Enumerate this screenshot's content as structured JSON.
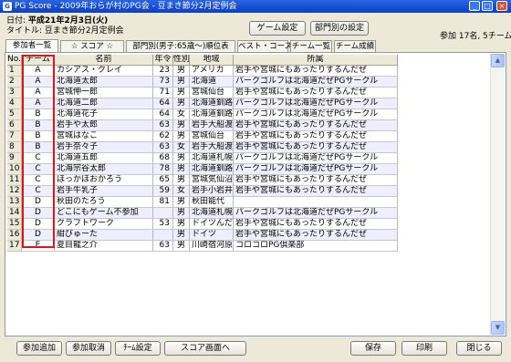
{
  "window": {
    "title": "PG Score - 2009年おらが村のPG会 - 豆まき節分2月定例会",
    "icon": "pg-app-icon"
  },
  "event": {
    "date_label": "日付:",
    "date_value": "平成21年2月3日(火)",
    "title_label": "タイトル:",
    "title_value": "豆まき節分2月定例会"
  },
  "buttons": {
    "game_settings": "ゲーム設定",
    "dept_settings": "部門別の設定"
  },
  "summary": "参加 17名, 5チーム",
  "tabs": [
    "参加者一覧",
    "☆ スコア ☆",
    "部門別(男子:65歳～)順位表",
    "ベスト・コース",
    "チーム一覧",
    "チーム成績"
  ],
  "table": {
    "headers": [
      "No.",
      "チーム",
      "名前",
      "年令",
      "性別",
      "地域",
      "所属"
    ],
    "rows": [
      [
        "1",
        "A",
        "カシアス・クレイ",
        "23",
        "男",
        "アメリカ",
        "岩手や宮城にもあったりするんだぜ"
      ],
      [
        "2",
        "A",
        "北海道太郎",
        "73",
        "男",
        "北海道",
        "パークゴルフは北海道だぜPGサークル"
      ],
      [
        "3",
        "A",
        "宮城伸一郎",
        "71",
        "男",
        "宮城仙台",
        "岩手や宮城にもあったりするんだぜ"
      ],
      [
        "4",
        "A",
        "北海道二郎",
        "64",
        "男",
        "北海道釧路",
        "パークゴルフは北海道だぜPGサークル"
      ],
      [
        "5",
        "B",
        "北海道花子",
        "64",
        "女",
        "北海道釧路",
        "パークゴルフは北海道だぜPGサークル"
      ],
      [
        "6",
        "B",
        "岩手や太郎",
        "63",
        "男",
        "岩手大船渡",
        "岩手や宮城にもあったりするんだぜ"
      ],
      [
        "7",
        "B",
        "宮城はなこ",
        "62",
        "男",
        "宮城仙台",
        "岩手や宮城にもあったりするんだぜ"
      ],
      [
        "8",
        "B",
        "岩手奈々子",
        "63",
        "女",
        "岩手大船渡",
        "岩手や宮城にもあったりするんだぜ"
      ],
      [
        "9",
        "C",
        "北海道五郎",
        "68",
        "男",
        "北海道札幌",
        "パークゴルフは北海道だぜPGサークル"
      ],
      [
        "10",
        "C",
        "北海宗谷太郎",
        "78",
        "男",
        "北海道釧路",
        "パークゴルフは北海道だぜPGサークル"
      ],
      [
        "11",
        "C",
        "ほっかほおかろう",
        "65",
        "男",
        "宮城気仙沼",
        "岩手や宮城にもあったりするんだぜ"
      ],
      [
        "12",
        "C",
        "岩手牛乳子",
        "59",
        "女",
        "岩手小岩井",
        "岩手や宮城にもあったりするんだぜ"
      ],
      [
        "13",
        "D",
        "秋田のたろう",
        "81",
        "男",
        "秋田能代",
        ""
      ],
      [
        "14",
        "D",
        "どこにもゲーム不参加",
        "",
        "男",
        "北海道札幌",
        "パークゴルフは北海道だぜPGサークル"
      ],
      [
        "15",
        "D",
        "クラフトワーク",
        "53",
        "男",
        "ドイツんだ",
        "岩手や宮城にもあったりするんだぜ"
      ],
      [
        "16",
        "D",
        "紺びゅーた",
        "",
        "男",
        "ドイツ",
        "岩手や宮城にもあったりするんだぜ"
      ],
      [
        "17",
        "E",
        "夏目龍之介",
        "63",
        "男",
        "川崎宿河原",
        "コロコロPG倶楽部"
      ]
    ]
  },
  "footer": {
    "add": "参加追加",
    "cancel": "参加取消",
    "team_settings": "ﾁｰﾑ設定",
    "to_score": "スコア画面へ",
    "save": "保存",
    "print": "印刷",
    "close": "閉じる"
  },
  "colors": {
    "titlebar": "#0a3fc8",
    "highlight": "#e0151c",
    "row_alt": "#eeeefc",
    "chrome": "#ece9d8"
  }
}
